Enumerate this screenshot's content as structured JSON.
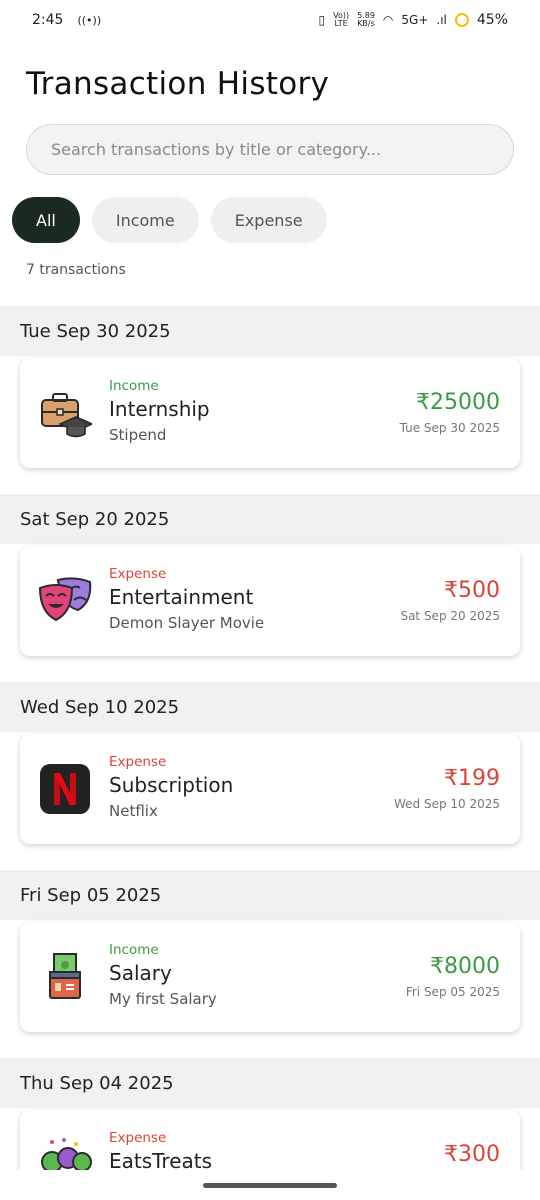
{
  "status": {
    "time": "2:45",
    "battery": "45%",
    "net_speed_top": "5.89",
    "net_speed_bottom": "KB/s",
    "network": "5G+",
    "volte_top": "Vo))",
    "volte_bottom": "LTE"
  },
  "title": "Transaction History",
  "search": {
    "placeholder": "Search transactions by title or category...",
    "value": ""
  },
  "filters": [
    {
      "label": "All",
      "active": true
    },
    {
      "label": "Income",
      "active": false
    },
    {
      "label": "Expense",
      "active": false
    }
  ],
  "count_text": "7 transactions",
  "colors": {
    "income": "#3b9a45",
    "expense": "#d9453a",
    "active_chip": "#1b2a1f"
  },
  "groups": [
    {
      "date": "Tue Sep 30 2025",
      "tx": {
        "type": "Income",
        "category": "Internship",
        "description": "Stipend",
        "amount": "₹25000",
        "date": "Tue Sep 30 2025",
        "icon": "briefcase-graduation-icon"
      }
    },
    {
      "date": "Sat Sep 20 2025",
      "tx": {
        "type": "Expense",
        "category": "Entertainment",
        "description": "Demon Slayer Movie",
        "amount": "₹500",
        "date": "Sat Sep 20 2025",
        "icon": "theater-masks-icon"
      }
    },
    {
      "date": "Wed Sep 10 2025",
      "tx": {
        "type": "Expense",
        "category": "Subscription",
        "description": "Netflix",
        "amount": "₹199",
        "date": "Wed Sep 10 2025",
        "icon": "netflix-logo-icon"
      }
    },
    {
      "date": "Fri Sep 05 2025",
      "tx": {
        "type": "Income",
        "category": "Salary",
        "description": "My first Salary",
        "amount": "₹8000",
        "date": "Fri Sep 05 2025",
        "icon": "salary-money-icon"
      }
    },
    {
      "date": "Thu Sep 04 2025",
      "tx": {
        "type": "Expense",
        "category": "EatsTreats",
        "description": "",
        "amount": "₹300",
        "date": "",
        "icon": "food-treats-icon"
      }
    }
  ]
}
